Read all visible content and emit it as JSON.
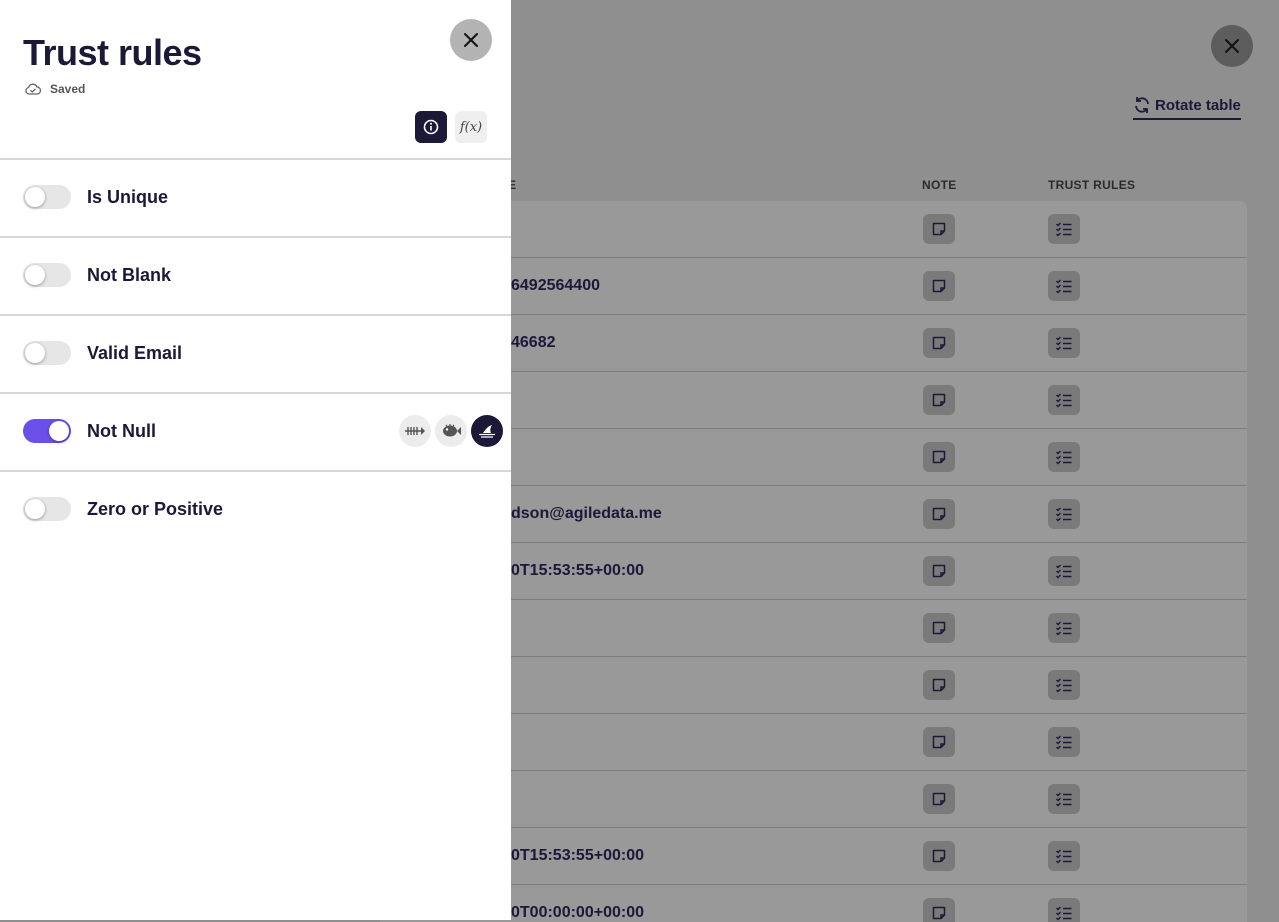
{
  "drawer": {
    "title": "Trust rules",
    "status": "Saved",
    "close_icon": "close-icon",
    "modes": [
      {
        "icon": "info-icon",
        "active": true
      },
      {
        "icon": "function-icon",
        "label": "f(x)",
        "active": false
      }
    ],
    "rules": [
      {
        "label": "Is Unique",
        "enabled": false
      },
      {
        "label": "Not Blank",
        "enabled": false
      },
      {
        "label": "Valid Email",
        "enabled": false
      },
      {
        "label": "Not Null",
        "enabled": true,
        "severity_options": [
          "fish-bones-icon",
          "pufferfish-icon",
          "shark-fin-icon"
        ],
        "selected_severity": "shark-fin-icon"
      },
      {
        "label": "Zero or Positive",
        "enabled": false
      }
    ],
    "accent_color": "#6b4fe8",
    "text_color": "#1c1838"
  },
  "background": {
    "rotate_label": "Rotate table",
    "columns": {
      "partial": "E",
      "note": "NOTE",
      "trust_rules": "TRUST RULES"
    },
    "rows": [
      {
        "value": ""
      },
      {
        "value": "6492564400"
      },
      {
        "value": "46682"
      },
      {
        "value": ""
      },
      {
        "value": ""
      },
      {
        "value": "dson@agiledata.me"
      },
      {
        "value": "0T15:53:55+00:00"
      },
      {
        "value": ""
      },
      {
        "value": ""
      },
      {
        "value": ""
      },
      {
        "value": ""
      },
      {
        "value": "0T15:53:55+00:00"
      },
      {
        "value": "0T00:00:00+00:00"
      }
    ]
  }
}
